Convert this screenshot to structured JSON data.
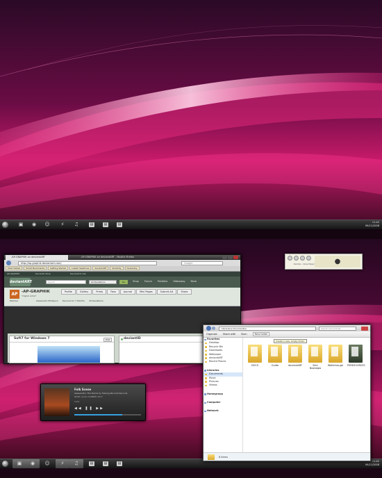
{
  "top_taskbar": {
    "clock_time": "11:42",
    "clock_date": "09/11/2008"
  },
  "bottom_taskbar": {
    "clock_time": "11:42",
    "clock_date": "09/11/2008"
  },
  "browser": {
    "window_title": "-AP-GRAPHIK on deviantART - Mozilla Firefox",
    "tab_label": "-AP-GRAPHIK on deviantART",
    "url": "http://ap-graphik.deviantart.com/",
    "search_placeholder": "Google",
    "bookmarks": [
      "Most Visited",
      "Smart Bookmarks",
      "Getting Started",
      "Latest Headlines",
      "deviantART",
      "ShellCity",
      "Deviantsy"
    ],
    "site_bar": {
      "item1": "AP-GRAPHIK",
      "item2": "Deviants Shop",
      "item3": "DeviantArt Lite"
    },
    "deviantart": {
      "logo_text": "deviantART",
      "search_placeholder": "Search",
      "search_scope": "All Deviations",
      "go_label": "Go",
      "menu": [
        "Shop",
        "Forum",
        "Portfolio",
        "Hideaway",
        "More"
      ],
      "username": "-AP-GRAPHIK",
      "tagline": "\"Digital Artist\"",
      "tabs": [
        "Profile",
        "Gallery",
        "Prints",
        "Favs",
        "Journal",
        "Mini Pages",
        "Submit Art",
        "Share"
      ],
      "info": [
        "Member",
        "Alessandro Phillipson",
        "Devious for 7 Months",
        "18 Deviations"
      ],
      "card1_title": "Soft7 for Windows 7",
      "card1_edit": "Edit",
      "card2_title": "deviantID"
    }
  },
  "media_widget": {
    "label": "Rambo - Now Playing",
    "logo": ""
  },
  "explorer": {
    "address": "Libraries ▸ Documents ▸",
    "search_placeholder": "Search Documents",
    "toolbar": [
      "Organize",
      "Share with",
      "Burn",
      "New folder"
    ],
    "tooltip": "Create a new, empty folder.",
    "sidebar": [
      {
        "label": "Favorites",
        "hdr": true
      },
      {
        "label": "Desktop"
      },
      {
        "label": "Recycle Bin"
      },
      {
        "label": "Downloads"
      },
      {
        "label": "Wallpaper"
      },
      {
        "label": "deviantART"
      },
      {
        "label": "Recent Places"
      },
      {
        "label": "",
        "gap": true
      },
      {
        "label": "Libraries",
        "hdr": true
      },
      {
        "label": "Documents",
        "sel": true
      },
      {
        "label": "Music"
      },
      {
        "label": "Pictures"
      },
      {
        "label": "Videos"
      },
      {
        "label": "",
        "gap": true
      },
      {
        "label": "Homegroup",
        "hdr": true
      },
      {
        "label": "",
        "gap": true
      },
      {
        "label": "Computer",
        "hdr": true
      },
      {
        "label": "",
        "gap": true
      },
      {
        "label": "Network",
        "hdr": true
      }
    ],
    "folders": [
      {
        "name": "DOCS"
      },
      {
        "name": "Guide"
      },
      {
        "name": "deviantART"
      },
      {
        "name": "Skin Nostalgia"
      },
      {
        "name": "Walkthrough"
      },
      {
        "name": "PSRESOURCES",
        "dark": true
      }
    ],
    "status": "6 items"
  },
  "media_player": {
    "title": "Folk Scene",
    "artist": "Alessandro: The Remix by Felleng Recordz Records",
    "album": "NIGEL Audio CAMBER 2017",
    "time": "1:24",
    "progress": 0.72
  }
}
